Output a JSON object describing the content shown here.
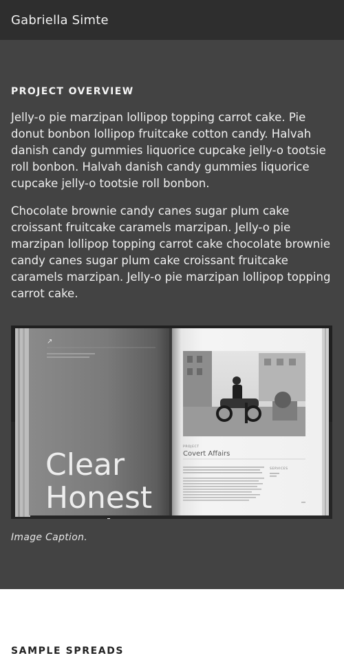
{
  "header": {
    "site_title": "Gabriella Simte"
  },
  "overview": {
    "heading": "PROJECT OVERVIEW",
    "paragraphs": [
      "Jelly-o pie marzipan lollipop topping carrot cake. Pie donut bonbon lollipop fruitcake cotton candy. Halvah danish candy gummies liquorice cupcake jelly-o tootsie roll bonbon. Halvah danish candy gummies liquorice cupcake jelly-o tootsie roll bonbon.",
      "Chocolate brownie candy canes sugar plum cake croissant fruitcake caramels marzipan. Jelly-o pie marzipan lollipop topping carrot cake chocolate brownie candy canes sugar plum cake croissant fruitcake caramels marzipan. Jelly-o pie marzipan lollipop topping carrot cake."
    ],
    "image": {
      "left_page_title_lines": [
        "Clear",
        "Honest",
        "Work"
      ],
      "right_page_project_label": "PROJECT",
      "right_page_project_name": "Covert Affairs",
      "right_page_services_label": "SERVICES"
    },
    "caption": "Image Caption."
  },
  "samples": {
    "heading": "SAMPLE SPREADS"
  },
  "colors": {
    "topbar": "#2e2e2e",
    "section_bg": "#434343",
    "text": "#f0f0f0"
  }
}
